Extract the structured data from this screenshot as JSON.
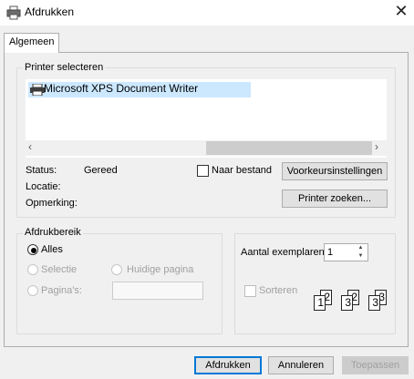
{
  "window": {
    "title": "Afdrukken"
  },
  "tabs": [
    {
      "label": "Algemeen"
    }
  ],
  "printer_group": {
    "title": "Printer selecteren",
    "printers": [
      {
        "name": "Microsoft XPS Document Writer",
        "selected": true
      }
    ],
    "status_label": "Status:",
    "status_value": "Gereed",
    "location_label": "Locatie:",
    "comment_label": "Opmerking:",
    "print_to_file_label": "Naar bestand",
    "preferences_button": "Voorkeursinstellingen",
    "find_printer_button": "Printer zoeken..."
  },
  "range_group": {
    "title": "Afdrukbereik",
    "all_label": "Alles",
    "selection_label": "Selectie",
    "current_page_label": "Huidige pagina",
    "pages_label": "Pagina's:",
    "pages_value": ""
  },
  "copies_group": {
    "copies_label": "Aantal exemplaren:",
    "copies_value": "1",
    "collate_label": "Sorteren",
    "collate_pages": [
      "1",
      "2",
      "3"
    ]
  },
  "buttons": {
    "print": "Afdrukken",
    "cancel": "Annuleren",
    "apply": "Toepassen"
  }
}
